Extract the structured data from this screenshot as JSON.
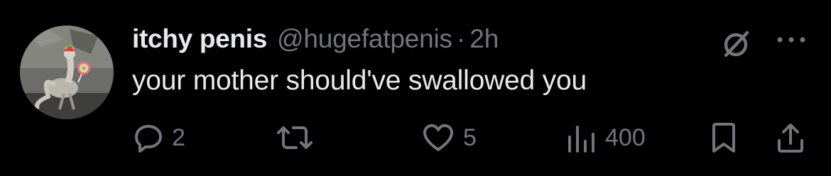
{
  "post": {
    "author": {
      "display_name": "itchy penis",
      "handle": "@hugefatpenis",
      "separator": "·",
      "time": "2h",
      "avatar": "avatar-image"
    },
    "text": "your mother should've swallowed you",
    "actions": {
      "reply": {
        "icon": "reply-icon",
        "count": "2"
      },
      "repost": {
        "icon": "repost-icon",
        "count": ""
      },
      "like": {
        "icon": "heart-icon",
        "count": "5"
      },
      "views": {
        "icon": "views-icon",
        "count": "400"
      },
      "bookmark": {
        "icon": "bookmark-icon"
      },
      "share": {
        "icon": "share-icon"
      }
    },
    "top_right": {
      "grok": "grok-icon",
      "more": "more-icon"
    }
  },
  "colors": {
    "background": "#000000",
    "primary_text": "#e7e9ea",
    "secondary_text": "#71767b"
  }
}
